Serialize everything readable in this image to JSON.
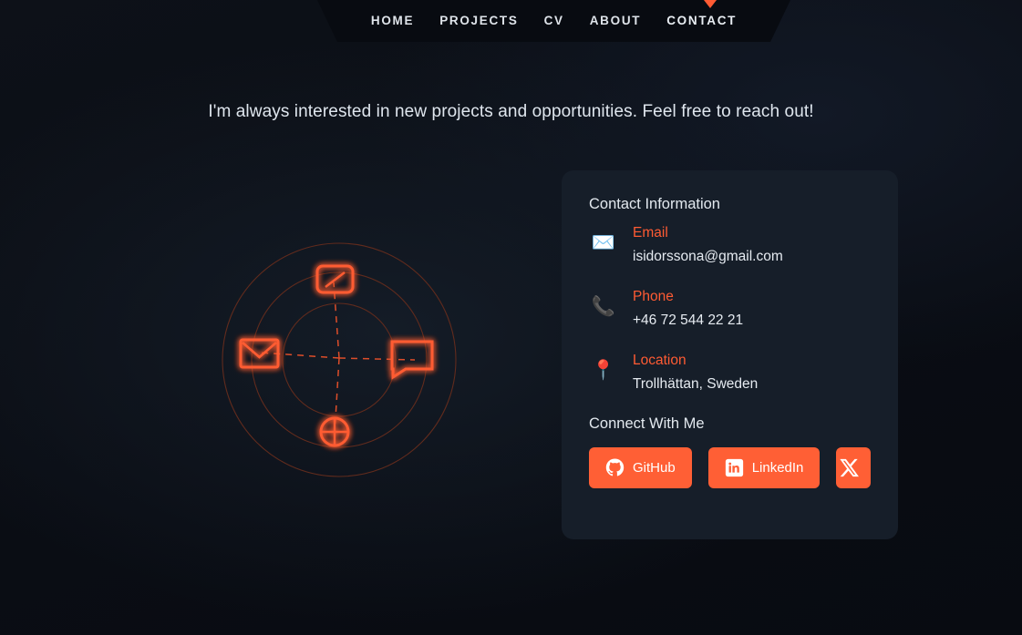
{
  "page": {
    "background_color": "#0a0d14",
    "accent_color": "#ff5f35",
    "card_color": "#161e29"
  },
  "nav": {
    "active": "CONTACT",
    "indicator_icon": "caret-down-icon",
    "items": [
      {
        "label": "HOME"
      },
      {
        "label": "PROJECTS"
      },
      {
        "label": "CV"
      },
      {
        "label": "ABOUT"
      },
      {
        "label": "CONTACT"
      }
    ]
  },
  "headline": {
    "text": "I'm always interested in new projects and opportunities. Feel free to reach out!"
  },
  "radar": {
    "nodes": [
      {
        "name": "send-node",
        "icon": "send-icon"
      },
      {
        "name": "mail-node",
        "icon": "envelope-icon"
      },
      {
        "name": "chat-node",
        "icon": "chat-bubble-icon"
      },
      {
        "name": "globe-node",
        "icon": "globe-icon"
      }
    ],
    "ring_color": "#5c2a1c",
    "node_color": "#ff5b33"
  },
  "card": {
    "title": "Contact Information",
    "rows": [
      {
        "icon": "envelope-icon",
        "glyph": "✉️",
        "label": "Email",
        "value": "isidorssona@gmail.com"
      },
      {
        "icon": "phone-icon",
        "glyph": "📞",
        "label": "Phone",
        "value": "+46 72 544 22 21"
      },
      {
        "icon": "location-pin-icon",
        "glyph": "📍",
        "label": "Location",
        "value": "Trollhättan, Sweden"
      }
    ],
    "connect_title": "Connect With Me",
    "social": [
      {
        "name": "github",
        "label": "GitHub",
        "icon": "github-icon"
      },
      {
        "name": "linkedin",
        "label": "LinkedIn",
        "icon": "linkedin-icon"
      },
      {
        "name": "x-twitter",
        "label": "",
        "icon": "x-icon"
      }
    ]
  }
}
